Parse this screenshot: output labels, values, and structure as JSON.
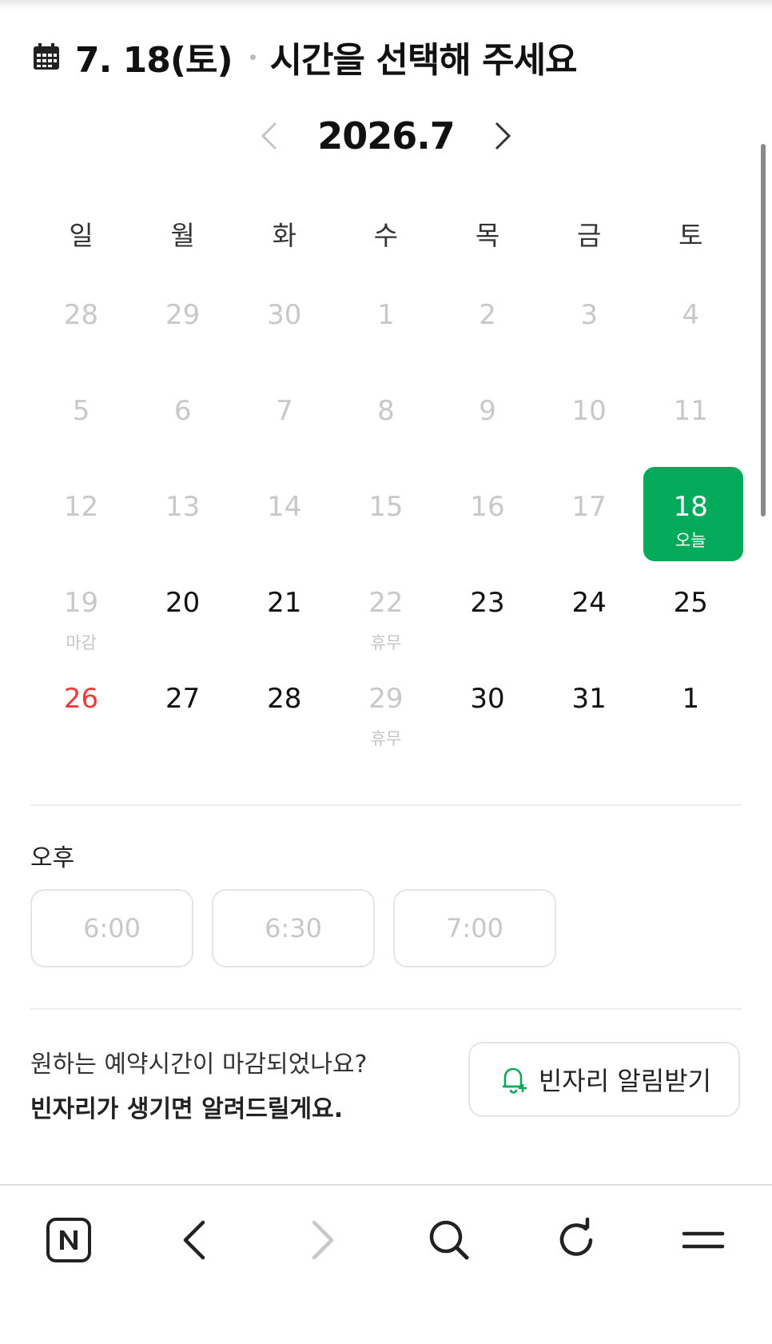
{
  "header": {
    "date": "7. 18(토)",
    "prompt": "시간을 선택해 주세요"
  },
  "calendar": {
    "month_label": "2026.7",
    "weekdays": [
      "일",
      "월",
      "화",
      "수",
      "목",
      "금",
      "토"
    ],
    "weeks": [
      [
        {
          "n": "28",
          "s": "dis"
        },
        {
          "n": "29",
          "s": "dis"
        },
        {
          "n": "30",
          "s": "dis"
        },
        {
          "n": "1",
          "s": "dis"
        },
        {
          "n": "2",
          "s": "dis"
        },
        {
          "n": "3",
          "s": "dis"
        },
        {
          "n": "4",
          "s": "dis"
        }
      ],
      [
        {
          "n": "5",
          "s": "dis"
        },
        {
          "n": "6",
          "s": "dis"
        },
        {
          "n": "7",
          "s": "dis"
        },
        {
          "n": "8",
          "s": "dis"
        },
        {
          "n": "9",
          "s": "dis"
        },
        {
          "n": "10",
          "s": "dis"
        },
        {
          "n": "11",
          "s": "dis"
        }
      ],
      [
        {
          "n": "12",
          "s": "dis"
        },
        {
          "n": "13",
          "s": "dis"
        },
        {
          "n": "14",
          "s": "dis"
        },
        {
          "n": "15",
          "s": "dis"
        },
        {
          "n": "16",
          "s": "dis"
        },
        {
          "n": "17",
          "s": "dis"
        },
        {
          "n": "18",
          "s": "sel",
          "sub": "오늘"
        }
      ],
      [
        {
          "n": "19",
          "s": "dis",
          "sub": "마감"
        },
        {
          "n": "20",
          "s": "en"
        },
        {
          "n": "21",
          "s": "en"
        },
        {
          "n": "22",
          "s": "dis",
          "sub": "휴무"
        },
        {
          "n": "23",
          "s": "en"
        },
        {
          "n": "24",
          "s": "en"
        },
        {
          "n": "25",
          "s": "en"
        }
      ],
      [
        {
          "n": "26",
          "s": "sun"
        },
        {
          "n": "27",
          "s": "en"
        },
        {
          "n": "28",
          "s": "en"
        },
        {
          "n": "29",
          "s": "dis",
          "sub": "휴무"
        },
        {
          "n": "30",
          "s": "en"
        },
        {
          "n": "31",
          "s": "en"
        },
        {
          "n": "1",
          "s": "en"
        }
      ]
    ]
  },
  "times": {
    "period_label": "오후",
    "slots": [
      "6:00",
      "6:30",
      "7:00"
    ]
  },
  "notify": {
    "line1": "원하는 예약시간이 마감되었나요?",
    "line2": "빈자리가 생기면 알려드릴게요.",
    "button_label": "빈자리 알림받기"
  },
  "colors": {
    "accent": "#03aa5a",
    "sunday": "#f03a3a"
  },
  "icons": {
    "header": "calendar-icon",
    "prev": "chevron-left-icon",
    "next": "chevron-right-icon",
    "notify": "bell-plus-icon",
    "bottom_bar": [
      "naver-home-icon",
      "back-arrow-icon",
      "forward-arrow-icon",
      "search-icon",
      "refresh-icon",
      "menu-icon"
    ]
  }
}
